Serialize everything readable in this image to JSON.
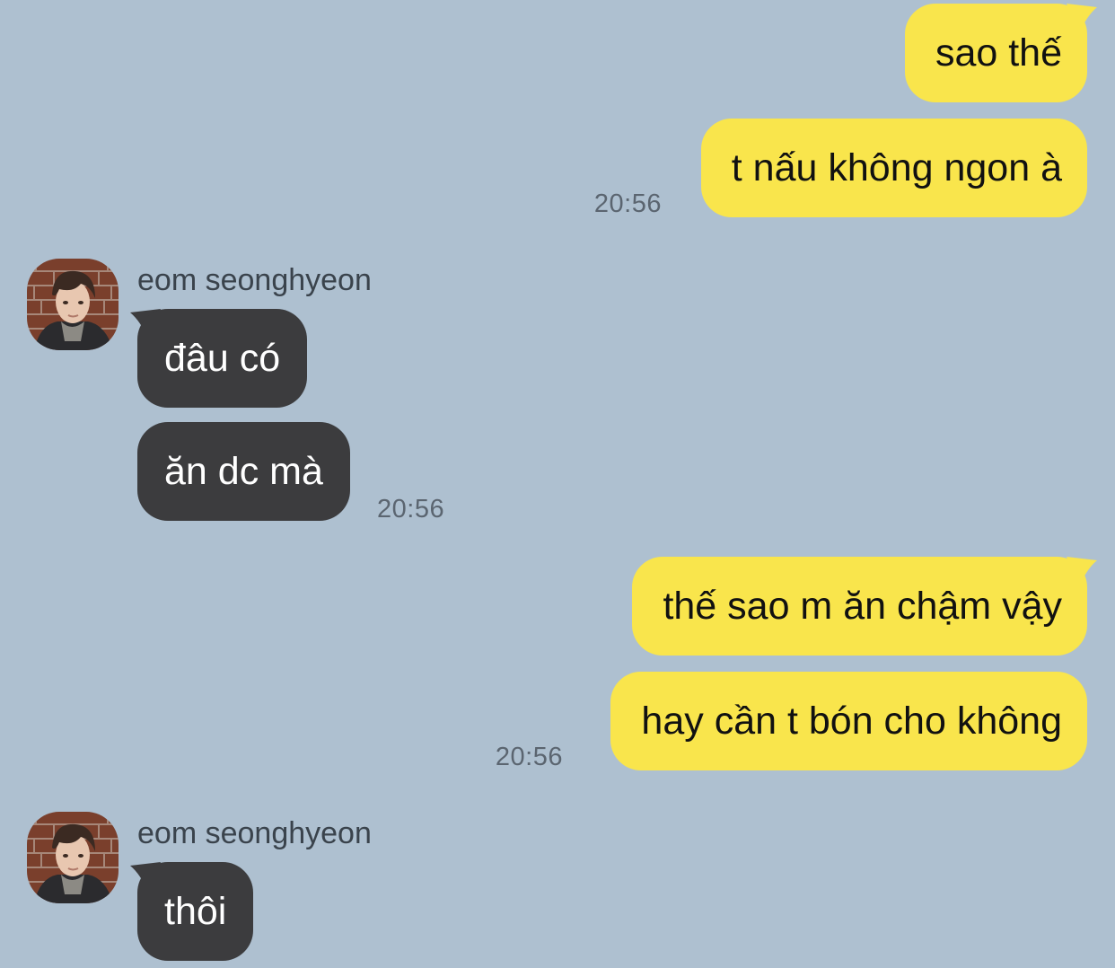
{
  "colors": {
    "background": "#aec0d0",
    "outgoing_bubble": "#f9e54c",
    "incoming_bubble": "#3c3c3e"
  },
  "messages": {
    "m1": "sao thế",
    "m2": "t nấu không ngon à",
    "m3": "đâu có",
    "m4": "ăn dc mà",
    "m5": "thế sao m ăn chậm vậy",
    "m6": "hay cần t bón cho không",
    "m7": "thôi"
  },
  "timestamps": {
    "t1": "20:56",
    "t2": "20:56",
    "t3": "20:56"
  },
  "senders": {
    "s1": "eom seonghyeon",
    "s2": "eom seonghyeon"
  },
  "icons": {
    "avatar": "profile-photo-avatar"
  }
}
